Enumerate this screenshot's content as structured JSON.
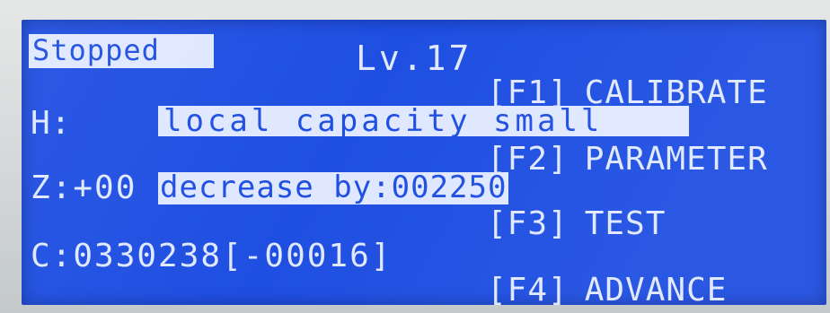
{
  "screen": {
    "status": "Stopped",
    "level": "Lv.17"
  },
  "rows": {
    "h": {
      "label": "H:",
      "value": "local capacity small"
    },
    "z": {
      "label": "Z:+00",
      "value": "decrease by:002250"
    },
    "c": {
      "value": "C:0330238[-00016]"
    }
  },
  "menu": [
    {
      "key": "[F1]",
      "label": "CALIBRATE"
    },
    {
      "key": "[F2]",
      "label": "PARAMETER"
    },
    {
      "key": "[F3]",
      "label": "TEST"
    },
    {
      "key": "[F4]",
      "label": "ADVANCE"
    }
  ],
  "colors": {
    "lcd_background": "#1f4fe2",
    "lcd_text": "#dfe8ff",
    "bezel": "#d9dcdc"
  }
}
